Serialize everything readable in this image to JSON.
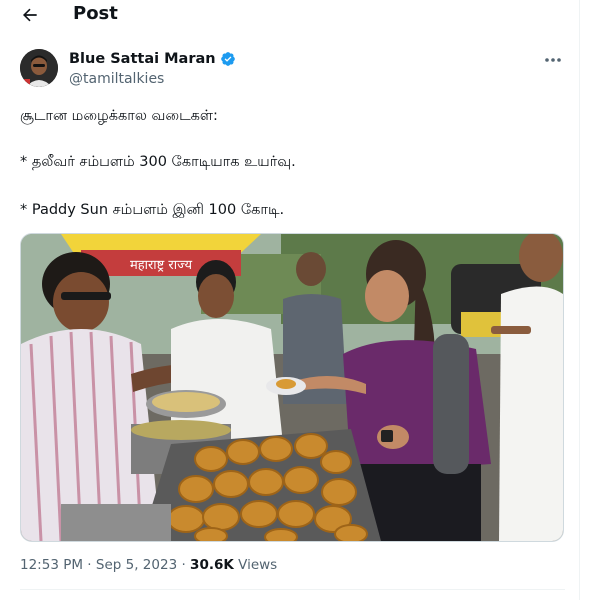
{
  "header": {
    "title": "Post"
  },
  "author": {
    "name": "Blue Sattai Maran",
    "handle": "@tamiltalkies",
    "verified": true,
    "verified_color": "#1d9bf0"
  },
  "tweet": {
    "lines": [
      "சூடான மழைக்கால வடைகள்:",
      "* தலீவர் சம்பளம் 300 கோடியாக உயர்வு.",
      "* Paddy Sun சம்பளம் இனி 100 கோடி."
    ]
  },
  "media": {
    "banner_text": "महाराष्ट्र राज्य"
  },
  "meta": {
    "time": "12:53 PM",
    "date": "Sep 5, 2023",
    "separator": "·",
    "views_count": "30.6K",
    "views_label": "Views"
  },
  "colors": {
    "text": "#0f1419",
    "muted": "#536471",
    "accent": "#1d9bf0"
  }
}
